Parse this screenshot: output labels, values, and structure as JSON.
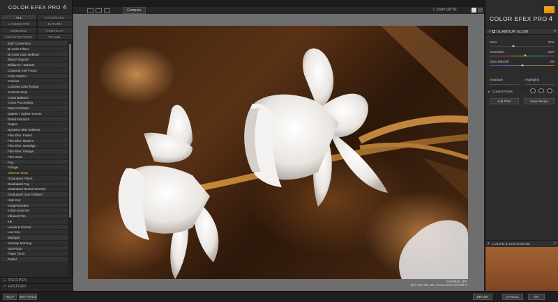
{
  "app": {
    "title": "COLOR EFEX PRO",
    "version": "4"
  },
  "categories": [
    {
      "label": "ALL",
      "active": true
    },
    {
      "label": "FAVORITES",
      "active": false
    },
    {
      "label": "LANDSCAPE",
      "active": false
    },
    {
      "label": "NATURE",
      "active": false
    },
    {
      "label": "WEDDING",
      "active": false
    },
    {
      "label": "PORTRAIT",
      "active": false
    },
    {
      "label": "ARCHITECTURE",
      "active": false
    },
    {
      "label": "TRAVEL",
      "active": false
    }
  ],
  "filters": [
    "B/W Conversion",
    "Bi-Color Filters",
    "Bi-Color User Defined",
    "Bleach Bypass",
    "Brilliance / Warmth",
    "Classical Soft Focus",
    "Color Stylizer",
    "Colorize",
    "Contrast Color Range",
    "Contrast Only",
    "Cross Balance",
    "Cross Processing",
    "Dark Contrasts",
    "Darken / Lighten Center",
    "Detail Extractor",
    "Duplex",
    "Dynamic Skin Softener",
    "Film Efex: Faded",
    "Film Efex: Modern",
    "Film Efex: Nostalgic",
    "Film Efex: Vintage",
    "Film Grain",
    "Fog",
    "Foliage",
    "Glamour Glow",
    "Graduated Filters",
    "Graduated Fog",
    "Graduated Neutral Density",
    "Graduated User Defined",
    "High Key",
    "Image Borders",
    "Indian Summer",
    "Infrared Film",
    "Ink",
    "Levels & Curves",
    "Low Key",
    "Midnight",
    "Monday Morning",
    "Old Photo",
    "Paper Toner",
    "Pastel"
  ],
  "selected_filter": "Glamour Glow",
  "sections": {
    "recipes": "RECIPES",
    "history": "HISTORY"
  },
  "topbar": {
    "compare": "Compare",
    "zoom": "Zoom (58 %)"
  },
  "caption": {
    "filename": "SAM0848 .JPG",
    "info": "18.4 MP, ISO 100, Canon EOS 7D Mark II"
  },
  "right_panel": {
    "filter_header": "GLAMOUR GLOW",
    "glow": {
      "label": "Glow",
      "value": "37%",
      "fraction": 0.37
    },
    "saturation": {
      "label": "Saturation",
      "value": "29%",
      "fraction": 0.55
    },
    "glow_warmth": {
      "label": "Glow Warmth",
      "value": "0%",
      "fraction": 0.5
    },
    "shadows": "Shadows",
    "highlights": "Highlights",
    "control_points": "Control Points",
    "add_filter": "Add Filter",
    "save_recipe": "Save Recipe",
    "loupe": "LOUPE & HISTOGRAM"
  },
  "bottom": {
    "help": "HELP",
    "settings": "SETTINGS",
    "brush": "BRUSH",
    "cancel": "CANCEL",
    "ok": "OK"
  },
  "colors": {
    "accent": "#f0c419",
    "logo": "#f6a623"
  }
}
